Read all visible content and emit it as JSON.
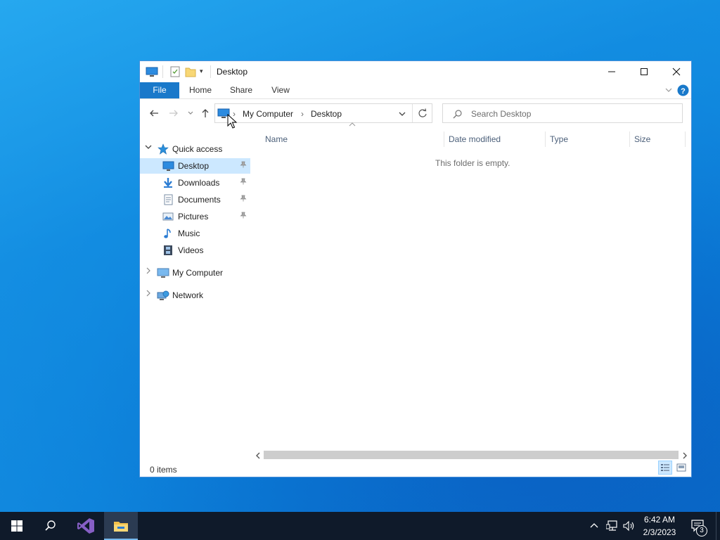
{
  "window": {
    "title": "Desktop",
    "ribbon_tabs": [
      "File",
      "Home",
      "Share",
      "View"
    ]
  },
  "address_bar": {
    "segments": [
      "My Computer",
      "Desktop"
    ]
  },
  "search": {
    "placeholder": "Search Desktop"
  },
  "nav_pane": {
    "quick_access": "Quick access",
    "quick_items": [
      {
        "label": "Desktop",
        "icon": "desktop-icon",
        "pinned": true,
        "selected": true
      },
      {
        "label": "Downloads",
        "icon": "downloads-icon",
        "pinned": true
      },
      {
        "label": "Documents",
        "icon": "documents-icon",
        "pinned": true
      },
      {
        "label": "Pictures",
        "icon": "pictures-icon",
        "pinned": true
      },
      {
        "label": "Music",
        "icon": "music-icon",
        "pinned": false
      },
      {
        "label": "Videos",
        "icon": "videos-icon",
        "pinned": false
      }
    ],
    "my_computer": "My Computer",
    "network": "Network"
  },
  "columns": [
    "Name",
    "Date modified",
    "Type",
    "Size"
  ],
  "content": {
    "empty_message": "This folder is empty."
  },
  "status": {
    "items": "0 items"
  },
  "taskbar": {
    "time": "6:42 AM",
    "date": "2/3/2023",
    "notification_count": "3"
  },
  "colors": {
    "accent": "#1979ca",
    "selection": "#cce8ff",
    "taskbar": "#0f1a2a"
  }
}
